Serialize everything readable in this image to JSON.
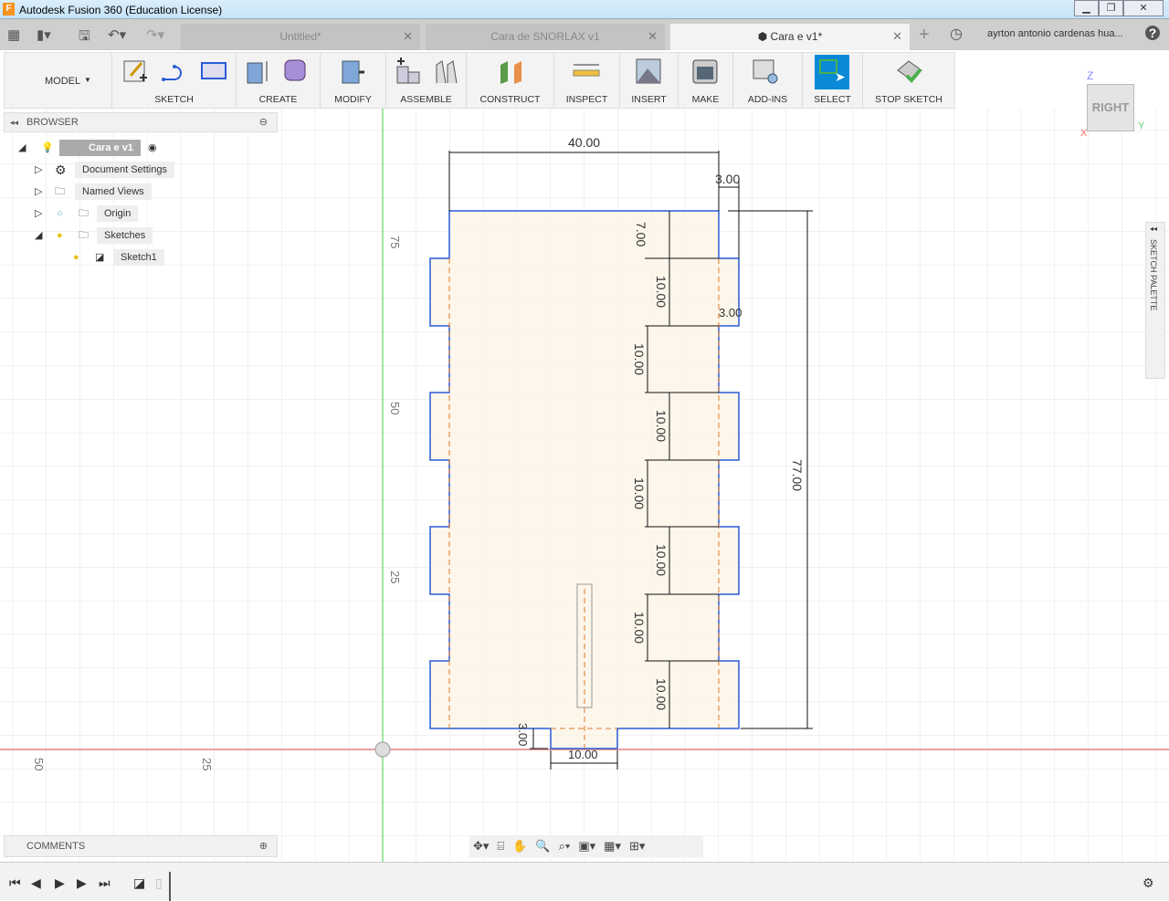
{
  "window": {
    "title": "Autodesk Fusion 360 (Education License)",
    "logo": "F"
  },
  "tabs": [
    {
      "label": "Untitled*"
    },
    {
      "label": "Cara de SNORLAX v1"
    },
    {
      "label": "Cara e v1*",
      "active": true
    }
  ],
  "user": "ayrton antonio cardenas hua...",
  "toolbar": {
    "workspace": "MODEL",
    "groups": [
      "SKETCH",
      "CREATE",
      "MODIFY",
      "ASSEMBLE",
      "CONSTRUCT",
      "INSPECT",
      "INSERT",
      "MAKE",
      "ADD-INS",
      "SELECT",
      "STOP SKETCH"
    ]
  },
  "browser": {
    "title": "BROWSER",
    "items": [
      {
        "label": "Cara e v1"
      },
      {
        "label": "Document Settings"
      },
      {
        "label": "Named Views"
      },
      {
        "label": "Origin"
      },
      {
        "label": "Sketches"
      },
      {
        "label": "Sketch1"
      }
    ]
  },
  "comments": {
    "title": "COMMENTS"
  },
  "palette": {
    "title": "SKETCH PALETTE"
  },
  "viewcube": {
    "face": "RIGHT",
    "z": "Z",
    "x": "X",
    "y": "Y"
  },
  "axis_labels": {
    "v75": "75",
    "v50": "50",
    "v25": "25",
    "h50": "50",
    "h25": "25"
  },
  "dimensions": {
    "width": "40.00",
    "offset_top": "3.00",
    "height": "77.00",
    "first": "7.00",
    "step": "10.00",
    "tab": "3.00",
    "bottom_tab_width": "10.00",
    "bottom_tab_height": "3.00"
  },
  "colors": {
    "sketch_line": "#2a5bd7",
    "fill": "#fdf4e8",
    "construction": "#e07a2a",
    "x_axis": "#e08080",
    "y_axis": "#80e080",
    "accent": "#0a8ad6"
  }
}
